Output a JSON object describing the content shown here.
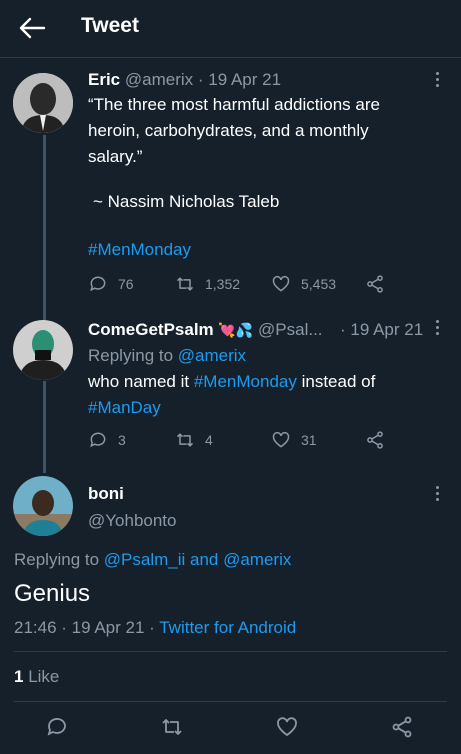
{
  "header": {
    "title": "Tweet"
  },
  "tweet1": {
    "name": "Eric",
    "handle": "@amerix",
    "date": "· 19 Apr 21",
    "line1": "“The three most harmful addictions are",
    "line2": "heroin, carbohydrates, and a monthly",
    "line3": "salary.”",
    "attribution": "~  Nassim Nicholas Taleb",
    "hashtag": "#MenMonday",
    "replies": "76",
    "retweets": "1,352",
    "likes": "5,453"
  },
  "tweet2": {
    "name": "ComeGetPsalm",
    "emoji": "💘💦",
    "handle": "@Psal...",
    "date": "· 19 Apr 21",
    "replying_prefix": "Replying to ",
    "replying_handle": "@amerix",
    "text_a": "who named it ",
    "text_hashtag": "#MenMonday",
    "text_b": " instead of",
    "text_hashtag2": "#ManDay",
    "replies": "3",
    "retweets": "4",
    "likes": "31"
  },
  "main_tweet": {
    "name": "boni",
    "handle": "@Yohbonto",
    "replying_prefix": "Replying to ",
    "replying_handle1": "@Psalm_ii",
    "replying_and": " and ",
    "replying_handle2": "@amerix",
    "text": "Genius",
    "time": "21:46 · 19 Apr 21 · ",
    "source": "Twitter for Android",
    "likes_count": "1",
    "likes_label": " Like"
  },
  "colors": {
    "background": "#15202b",
    "accent": "#1d9bf0",
    "muted": "#8b98a5"
  },
  "icons": {
    "back": "arrow-left-icon",
    "reply": "reply-icon",
    "retweet": "retweet-icon",
    "like": "heart-icon",
    "share": "share-icon",
    "more": "more-vertical-icon"
  }
}
